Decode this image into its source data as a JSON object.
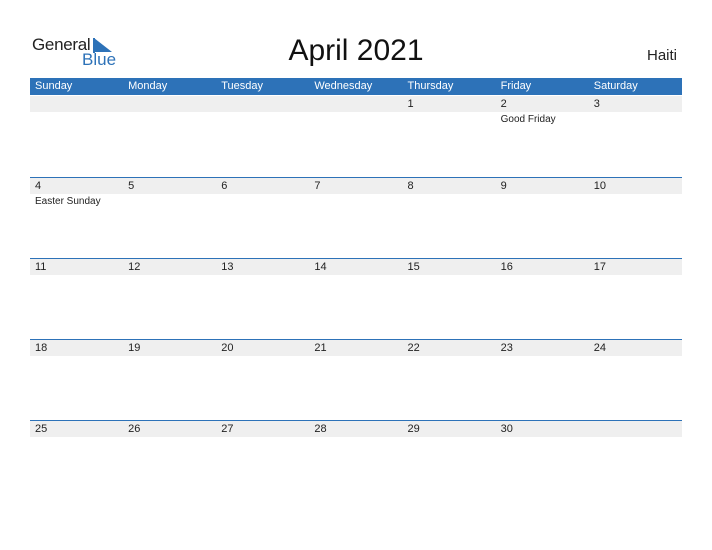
{
  "logo": {
    "line1": "General",
    "line2": "Blue"
  },
  "title": "April 2021",
  "country": "Haiti",
  "colors": {
    "accent": "#2d72b8",
    "date_strip": "#efefef"
  },
  "weekdays": [
    "Sunday",
    "Monday",
    "Tuesday",
    "Wednesday",
    "Thursday",
    "Friday",
    "Saturday"
  ],
  "weeks": [
    {
      "days": [
        {
          "num": "",
          "holiday": ""
        },
        {
          "num": "",
          "holiday": ""
        },
        {
          "num": "",
          "holiday": ""
        },
        {
          "num": "",
          "holiday": ""
        },
        {
          "num": "1",
          "holiday": ""
        },
        {
          "num": "2",
          "holiday": "Good Friday"
        },
        {
          "num": "3",
          "holiday": ""
        }
      ]
    },
    {
      "days": [
        {
          "num": "4",
          "holiday": "Easter Sunday"
        },
        {
          "num": "5",
          "holiday": ""
        },
        {
          "num": "6",
          "holiday": ""
        },
        {
          "num": "7",
          "holiday": ""
        },
        {
          "num": "8",
          "holiday": ""
        },
        {
          "num": "9",
          "holiday": ""
        },
        {
          "num": "10",
          "holiday": ""
        }
      ]
    },
    {
      "days": [
        {
          "num": "11",
          "holiday": ""
        },
        {
          "num": "12",
          "holiday": ""
        },
        {
          "num": "13",
          "holiday": ""
        },
        {
          "num": "14",
          "holiday": ""
        },
        {
          "num": "15",
          "holiday": ""
        },
        {
          "num": "16",
          "holiday": ""
        },
        {
          "num": "17",
          "holiday": ""
        }
      ]
    },
    {
      "days": [
        {
          "num": "18",
          "holiday": ""
        },
        {
          "num": "19",
          "holiday": ""
        },
        {
          "num": "20",
          "holiday": ""
        },
        {
          "num": "21",
          "holiday": ""
        },
        {
          "num": "22",
          "holiday": ""
        },
        {
          "num": "23",
          "holiday": ""
        },
        {
          "num": "24",
          "holiday": ""
        }
      ]
    },
    {
      "days": [
        {
          "num": "25",
          "holiday": ""
        },
        {
          "num": "26",
          "holiday": ""
        },
        {
          "num": "27",
          "holiday": ""
        },
        {
          "num": "28",
          "holiday": ""
        },
        {
          "num": "29",
          "holiday": ""
        },
        {
          "num": "30",
          "holiday": ""
        },
        {
          "num": "",
          "holiday": ""
        }
      ]
    }
  ]
}
